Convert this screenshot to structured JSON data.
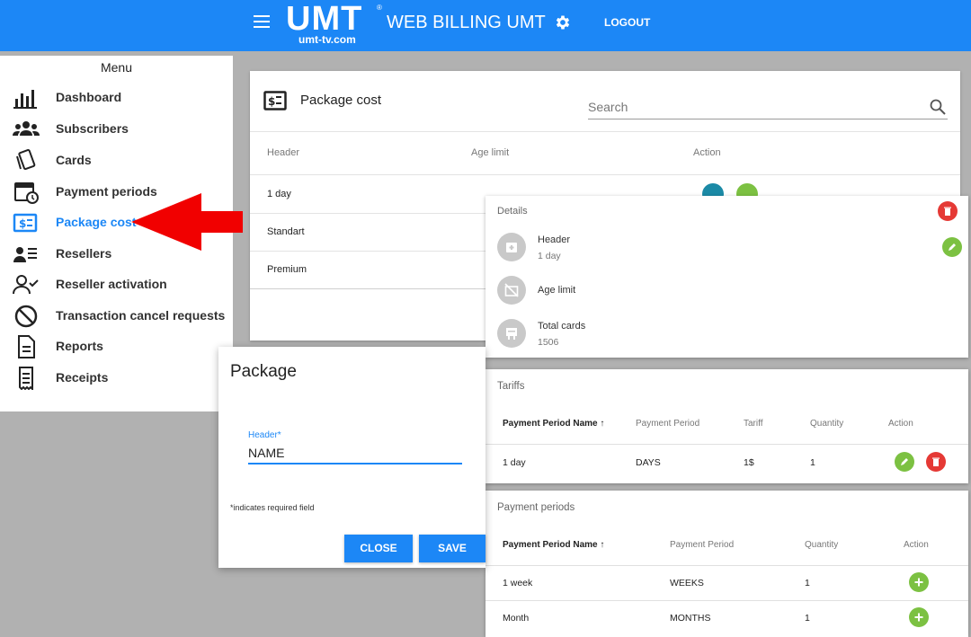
{
  "header": {
    "logo_text": "UMT",
    "logo_sub": "umt-tv.com",
    "logo_reg": "®",
    "title": "WEB BILLING UMT",
    "logout_label": "LOGOUT",
    "menu_icon": "hamburger-icon",
    "settings_icon": "gear-icon"
  },
  "sidebar": {
    "title": "Menu",
    "items": [
      {
        "label": "Dashboard",
        "icon": "bar-chart-icon"
      },
      {
        "label": "Subscribers",
        "icon": "users-icon"
      },
      {
        "label": "Cards",
        "icon": "cards-icon"
      },
      {
        "label": "Payment periods",
        "icon": "calendar-clock-icon"
      },
      {
        "label": "Package cost",
        "icon": "price-tag-icon",
        "active": true
      },
      {
        "label": "Resellers",
        "icon": "reseller-list-icon"
      },
      {
        "label": "Reseller activation",
        "icon": "user-check-icon"
      },
      {
        "label": "Transaction cancel requests",
        "icon": "cancel-icon"
      },
      {
        "label": "Reports",
        "icon": "document-icon"
      },
      {
        "label": "Receipts",
        "icon": "receipt-icon"
      }
    ]
  },
  "package_cost": {
    "title": "Package cost",
    "search_placeholder": "Search",
    "columns": [
      "Header",
      "Age limit",
      "Action"
    ],
    "rows": [
      "1 day",
      "Standart",
      "Premium"
    ]
  },
  "details": {
    "title": "Details",
    "header_label": "Header",
    "header_value": "1 day",
    "age_limit_label": "Age limit",
    "total_cards_label": "Total cards",
    "total_cards_value": "1506"
  },
  "tariffs": {
    "title": "Tariffs",
    "columns": [
      "Payment Period Name",
      "Payment Period",
      "Tariff",
      "Quantity",
      "Action"
    ],
    "sort_indicator": "↑",
    "rows": [
      {
        "name": "1 day",
        "period": "DAYS",
        "tariff": "1$",
        "quantity": "1"
      }
    ]
  },
  "payment_periods": {
    "title": "Payment periods",
    "columns": [
      "Payment Period Name",
      "Payment Period",
      "Quantity",
      "Action"
    ],
    "sort_indicator": "↑",
    "rows": [
      {
        "name": "1 week",
        "period": "WEEKS",
        "quantity": "1"
      },
      {
        "name": "Month",
        "period": "MONTHS",
        "quantity": "1"
      }
    ]
  },
  "dialog": {
    "title": "Package",
    "field_label": "Header*",
    "field_value": "NAME",
    "required_note": "*indicates required field",
    "close_label": "CLOSE",
    "save_label": "SAVE"
  },
  "colors": {
    "primary": "#1c87f6",
    "danger": "#e53935",
    "success": "#7cc142",
    "annotation_arrow": "#f10000"
  }
}
